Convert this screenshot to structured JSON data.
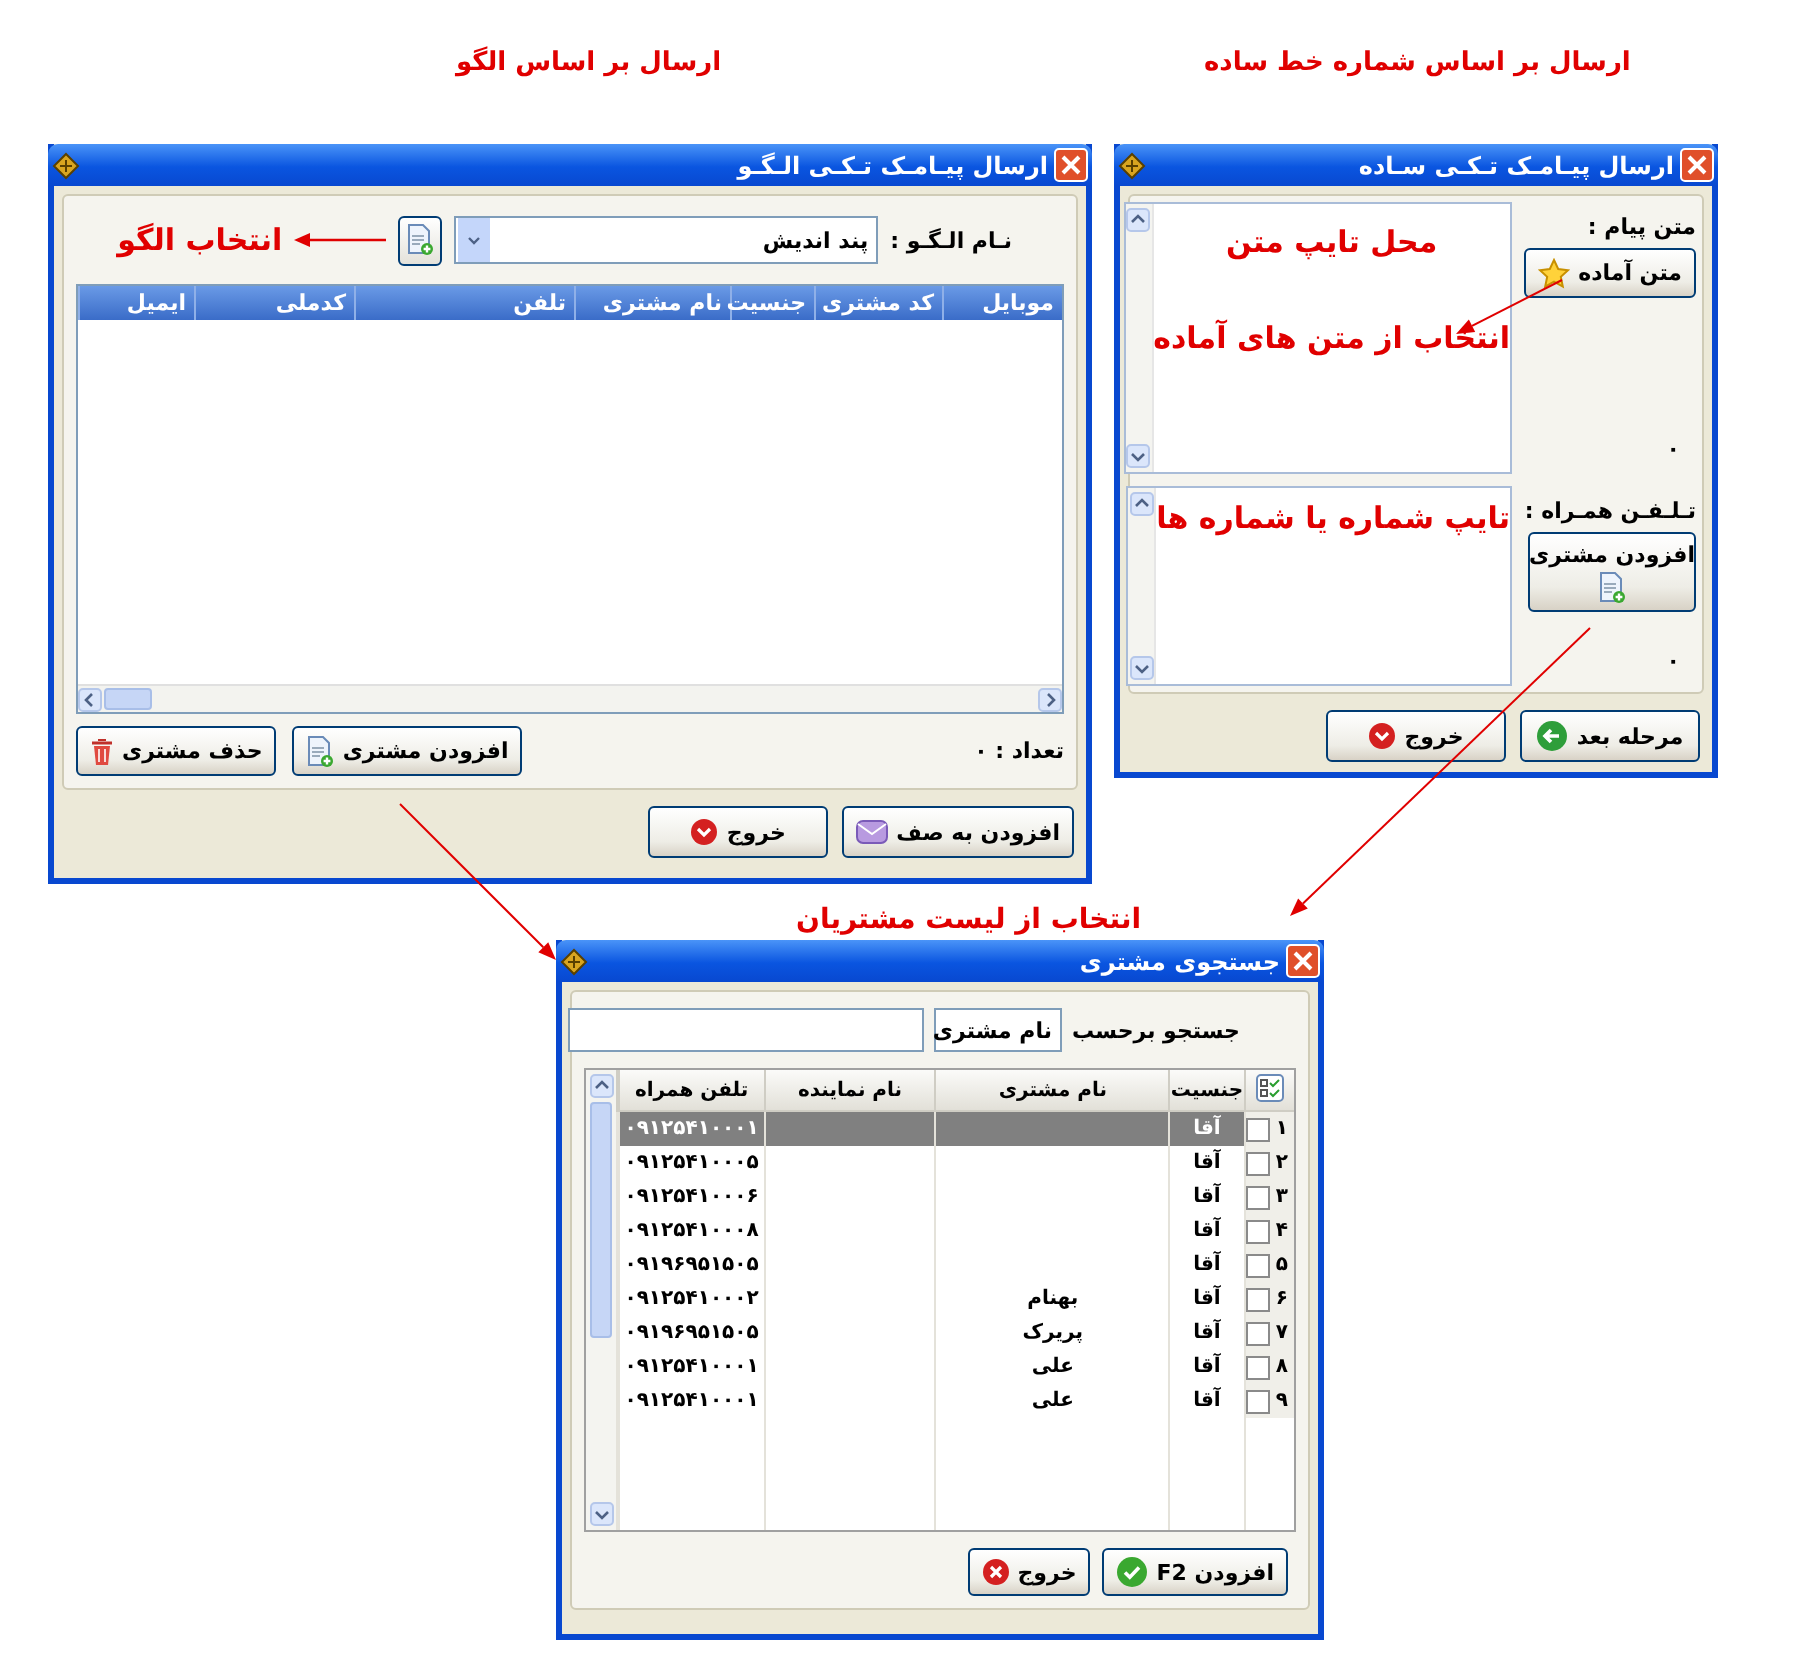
{
  "pattern_window": {
    "caption": "ارسال بر اساس الگو",
    "title": "ارسال پیـامـک تـکـی الـگـو",
    "pattern_label": "نـام الـگـو :",
    "pattern_value": "پند اندیش",
    "pattern_hint": "انتخاب الگو",
    "columns": [
      "موبایل",
      "کد مشتری",
      "جنسیت",
      "نام مشتری",
      "تلفن",
      "کدملی",
      "ایمیل"
    ],
    "count_label": "تعداد : ۰",
    "list_buttons": [
      {
        "label": "افزودن مشتری",
        "kind": "add"
      },
      {
        "label": "حذف مشتری",
        "kind": "delete"
      }
    ],
    "buttons": [
      {
        "label": "افزودن به صف",
        "kind": "queue"
      },
      {
        "label": "خروج",
        "kind": "exit"
      }
    ]
  },
  "simple_window": {
    "caption": "ارسال بر اساس شماره خط ساده",
    "title": "ارسال پیـامـک تـکـی سـاده",
    "message_label": "متن پیام :",
    "preset_button": {
      "label": "متن آماده",
      "kind": "preset"
    },
    "message_hints": [
      "محل تایپ متن",
      "انتخاب از متن های آماده"
    ],
    "message_count": "۰",
    "phone_label": "تـلـفـن همـراه :",
    "phone_hint": "تایپ شماره یا شماره ها",
    "add_button": {
      "label": "افزودن مشتری",
      "kind": "add"
    },
    "phone_count": "۰",
    "buttons": [
      {
        "label": "مرحله بعد",
        "kind": "next"
      },
      {
        "label": "خروج",
        "kind": "exit"
      }
    ]
  },
  "search_window": {
    "caption": "انتخاب از لیست مشتریان",
    "title": "جستجوی مشتری",
    "search_label": "جستجو برحسب",
    "search_by": "نام مشتری",
    "columns": [
      "جنسیت",
      "نام مشتری",
      "نام نماینده",
      "تلفن همراه"
    ],
    "rows": [
      {
        "number": "۱",
        "checked": false,
        "selected": true,
        "gender": "آقا",
        "phone": "۰۹۱۲۵۴۱۰۰۰۱"
      },
      {
        "number": "۲",
        "checked": false,
        "selected": false,
        "gender": "آقا",
        "phone": "۰۹۱۲۵۴۱۰۰۰۵"
      },
      {
        "number": "۳",
        "checked": false,
        "selected": false,
        "gender": "آقا",
        "phone": "۰۹۱۲۵۴۱۰۰۰۶"
      },
      {
        "number": "۴",
        "checked": false,
        "selected": false,
        "gender": "آقا",
        "phone": "۰۹۱۲۵۴۱۰۰۰۸"
      },
      {
        "number": "۵",
        "checked": false,
        "selected": false,
        "gender": "آقا",
        "phone": "۰۹۱۹۶۹۵۱۵۰۵"
      },
      {
        "number": "۶",
        "checked": false,
        "selected": false,
        "gender": "آقا",
        "name": "بهنام",
        "phone": "۰۹۱۲۵۴۱۰۰۰۲"
      },
      {
        "number": "۷",
        "checked": false,
        "selected": false,
        "gender": "آقا",
        "name": "پریرک",
        "phone": "۰۹۱۹۶۹۵۱۵۰۵"
      },
      {
        "number": "۸",
        "checked": false,
        "selected": false,
        "gender": "آقا",
        "name": "علی",
        "phone": "۰۹۱۲۵۴۱۰۰۰۱"
      },
      {
        "number": "۹",
        "checked": false,
        "selected": false,
        "gender": "آقا",
        "name": "علی",
        "phone": "۰۹۱۲۵۴۱۰۰۰۱"
      }
    ],
    "buttons": [
      {
        "label": "افزودن F2",
        "kind": "confirm"
      },
      {
        "label": "خروج",
        "kind": "cancel"
      }
    ]
  }
}
